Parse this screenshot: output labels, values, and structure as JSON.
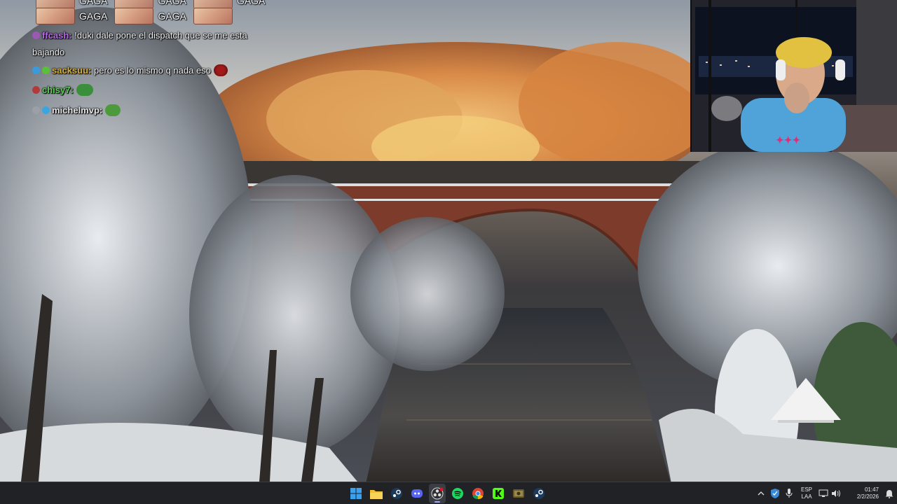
{
  "chat": {
    "emote_rows": [
      {
        "label": "GAGA",
        "emotes": 3
      }
    ],
    "emote_label": "GAGA",
    "messages": [
      {
        "user": "ffcash:",
        "text": " !duki dale pone el dispatch que se me esta bajando",
        "user_color": "#b46de0",
        "badges": [
          "#9b59b6"
        ]
      },
      {
        "user": "sacksuu:",
        "text": " pero es lo mismo q nada eso",
        "user_color": "#d8b23a",
        "badges": [
          "#3a9bdc",
          "#5bbf3a"
        ]
      },
      {
        "user": "chisy7:",
        "text": "",
        "user_color": "#5fd05a",
        "badges": [
          "#b33a3a"
        ]
      },
      {
        "user": "michelmvp:",
        "text": "",
        "user_color": "#e6e6e6",
        "badges": [
          "#9aa0a6",
          "#3aa6e0"
        ]
      }
    ]
  },
  "taskbar": {
    "apps": [
      {
        "name": "start",
        "icon": "windows-icon"
      },
      {
        "name": "file-explorer",
        "icon": "folder-icon"
      },
      {
        "name": "steam",
        "icon": "steam-icon"
      },
      {
        "name": "discord",
        "icon": "discord-icon"
      },
      {
        "name": "obs",
        "icon": "obs-icon",
        "active": true
      },
      {
        "name": "spotify",
        "icon": "spotify-icon"
      },
      {
        "name": "chrome",
        "icon": "chrome-icon"
      },
      {
        "name": "kick",
        "icon": "kick-icon"
      },
      {
        "name": "nvidia",
        "icon": "gpu-icon"
      },
      {
        "name": "steam-2",
        "icon": "steam-icon"
      }
    ],
    "tray": {
      "lang_top": "ESP",
      "lang_bottom": "LAA",
      "time": "01:47",
      "date": "2/2/2026"
    }
  },
  "colors": {
    "taskbar_bg": "#202226",
    "accent": "#9aa4ff"
  }
}
